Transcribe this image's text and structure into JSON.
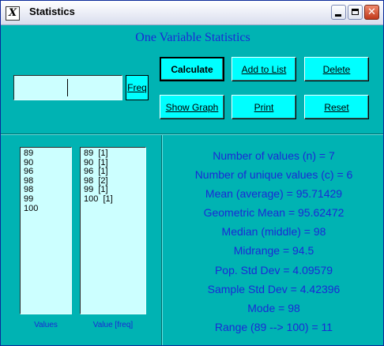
{
  "window": {
    "title": "Statistics",
    "app_icon": "X"
  },
  "titlebar_buttons": {
    "minimize_icon": "minimize-icon",
    "maximize_icon": "maximize-icon",
    "close_glyph": "✕"
  },
  "heading": "One Variable Statistics",
  "input": {
    "value": ""
  },
  "buttons": {
    "freq": "Freq",
    "calculate": "Calculate",
    "add_to_list": "Add to List",
    "delete": "Delete",
    "show_graph": "Show Graph",
    "print": "Print",
    "reset": "Reset"
  },
  "values_list": [
    "89",
    "90",
    "96",
    "98",
    "98",
    "99",
    "100"
  ],
  "value_freq_list": [
    "89  [1]",
    "90  [1]",
    "96  [1]",
    "98  [2]",
    "99  [1]",
    "100  [1]"
  ],
  "captions": {
    "values": "Values",
    "value_freq": "Value [freq]"
  },
  "results": [
    "Number of values (n) = 7",
    "Number of unique values (c) = 6",
    "Mean (average) = 95.71429",
    "Geometric Mean = 95.62472",
    "Median (middle) = 98",
    "Midrange = 94.5",
    "Pop. Std Dev = 4.09579",
    "Sample Std Dev = 4.42396",
    "Mode = 98",
    "Range (89 --> 100) = 11"
  ],
  "colors": {
    "background": "#00b3b3",
    "button": "#00ffff",
    "listbox": "#ccffff",
    "text": "#1a2ad6"
  }
}
